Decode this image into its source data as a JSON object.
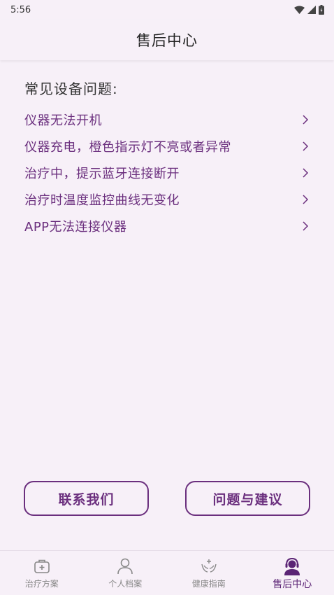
{
  "status_bar": {
    "time": "5:56",
    "icons": [
      "wifi-icon",
      "signal-icon",
      "battery-icon"
    ]
  },
  "app_bar": {
    "title": "售后中心"
  },
  "faq": {
    "section_title": "常见设备问题:",
    "items": [
      {
        "label": "仪器无法开机"
      },
      {
        "label": "仪器充电，橙色指示灯不亮或者异常"
      },
      {
        "label": "治疗中，提示蓝牙连接断开"
      },
      {
        "label": "治疗时温度监控曲线无变化"
      },
      {
        "label": "APP无法连接仪器"
      }
    ]
  },
  "actions": {
    "contact_label": "联系我们",
    "feedback_label": "问题与建议"
  },
  "bottom_nav": {
    "items": [
      {
        "label": "治疗方案",
        "icon": "medical-kit-icon",
        "active": false
      },
      {
        "label": "个人档案",
        "icon": "person-icon",
        "active": false
      },
      {
        "label": "健康指南",
        "icon": "hands-care-icon",
        "active": false
      },
      {
        "label": "售后中心",
        "icon": "customer-service-icon",
        "active": true
      }
    ]
  },
  "colors": {
    "accent": "#6b2f7e",
    "background": "#f7f0f8",
    "inactive": "#888888"
  }
}
